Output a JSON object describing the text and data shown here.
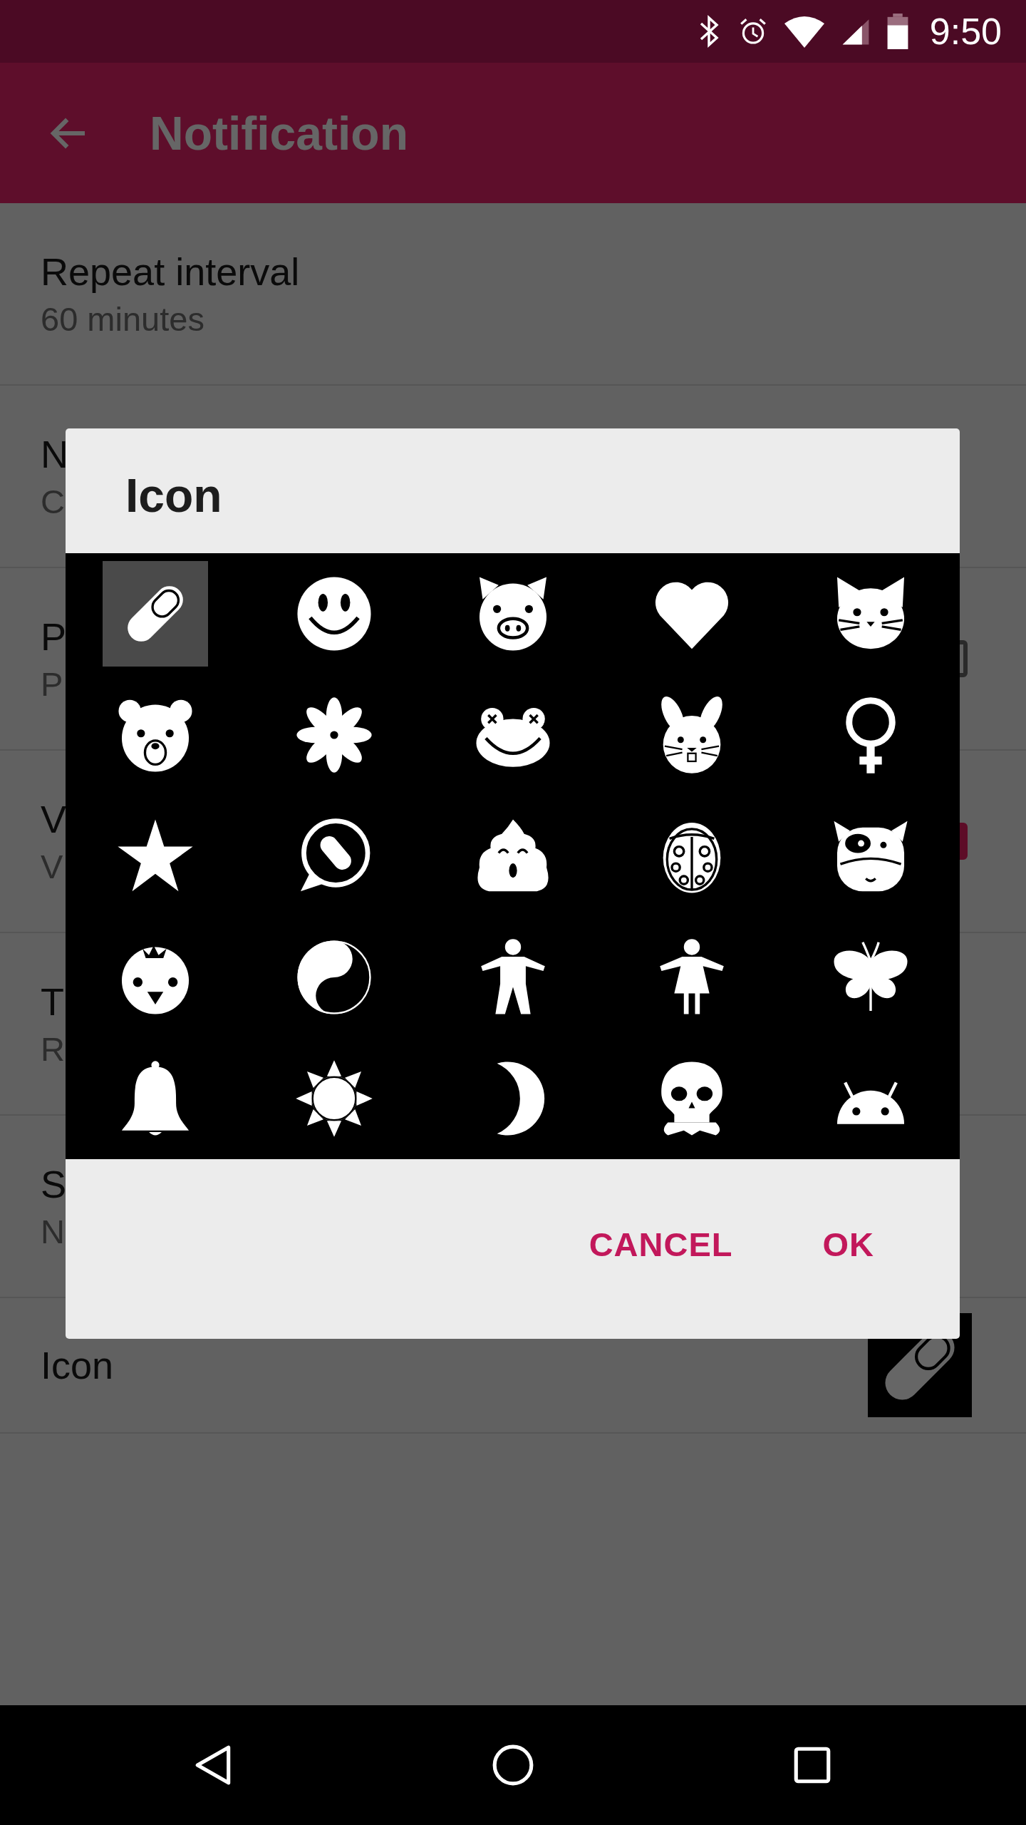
{
  "status_bar": {
    "time": "9:50"
  },
  "app_bar": {
    "title": "Notification"
  },
  "settings": [
    {
      "kind": "text",
      "title": "Repeat interval",
      "subtitle": "60 minutes"
    },
    {
      "kind": "text",
      "title": "N",
      "subtitle": "C"
    },
    {
      "kind": "checkbox",
      "title": "P",
      "subtitle": "P",
      "checked": false
    },
    {
      "kind": "checkbox",
      "title": "V",
      "subtitle": "V",
      "checked": true
    },
    {
      "kind": "text",
      "title": "T",
      "subtitle": "R"
    },
    {
      "kind": "text",
      "title": "S",
      "subtitle": "N"
    },
    {
      "kind": "icon",
      "title": "Icon"
    }
  ],
  "dialog": {
    "title": "Icon",
    "icons": [
      {
        "kind": "pill",
        "selected": true
      },
      {
        "kind": "smiley",
        "selected": false
      },
      {
        "kind": "pig",
        "selected": false
      },
      {
        "kind": "heart",
        "selected": false
      },
      {
        "kind": "cat",
        "selected": false
      },
      {
        "kind": "bear",
        "selected": false
      },
      {
        "kind": "flower",
        "selected": false
      },
      {
        "kind": "frog",
        "selected": false
      },
      {
        "kind": "rabbit",
        "selected": false
      },
      {
        "kind": "female-sign",
        "selected": false
      },
      {
        "kind": "star",
        "selected": false
      },
      {
        "kind": "speech-bubble",
        "selected": false
      },
      {
        "kind": "poop",
        "selected": false
      },
      {
        "kind": "ladybug",
        "selected": false
      },
      {
        "kind": "cow",
        "selected": false
      },
      {
        "kind": "chick",
        "selected": false
      },
      {
        "kind": "yin-yang",
        "selected": false
      },
      {
        "kind": "man",
        "selected": false
      },
      {
        "kind": "woman",
        "selected": false
      },
      {
        "kind": "butterfly",
        "selected": false
      },
      {
        "kind": "bell",
        "selected": false
      },
      {
        "kind": "sun",
        "selected": false
      },
      {
        "kind": "moon",
        "selected": false
      },
      {
        "kind": "skull",
        "selected": false
      },
      {
        "kind": "robot-head",
        "selected": false
      }
    ],
    "buttons": [
      "CANCEL",
      "OK"
    ]
  }
}
